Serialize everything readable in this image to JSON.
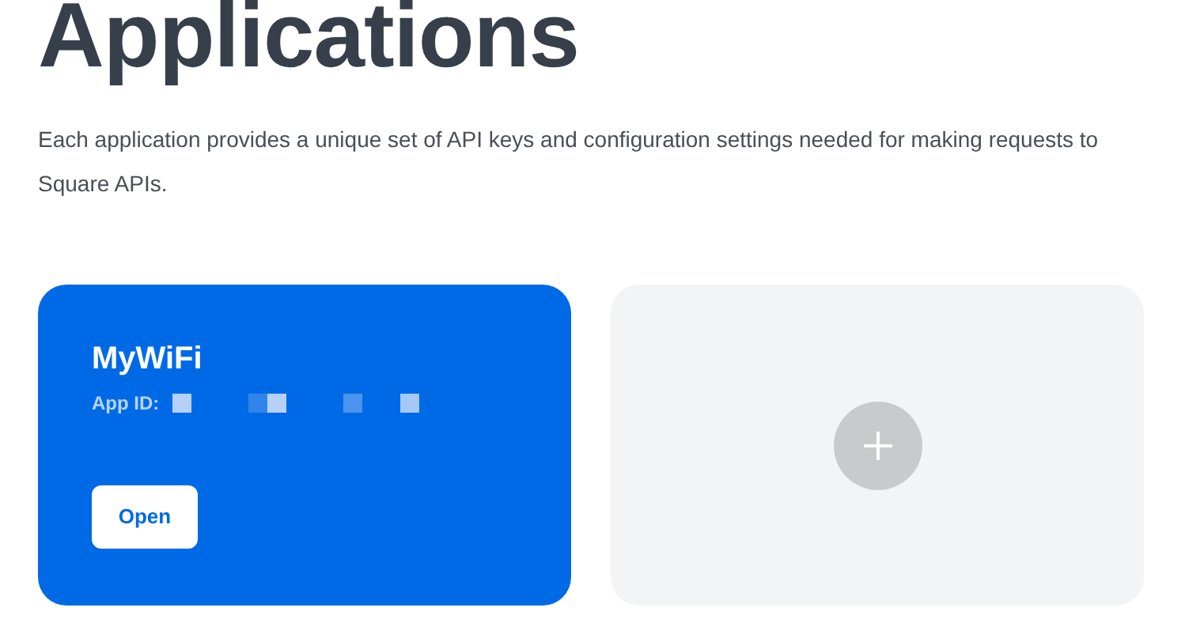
{
  "page": {
    "title": "Applications",
    "description": "Each application provides a unique set of API keys and configuration settings needed for making requests to Square APIs."
  },
  "apps": [
    {
      "name": "MyWiFi",
      "id_label": "App ID:",
      "button": "Open"
    }
  ],
  "add_card": {
    "kind": "add"
  }
}
